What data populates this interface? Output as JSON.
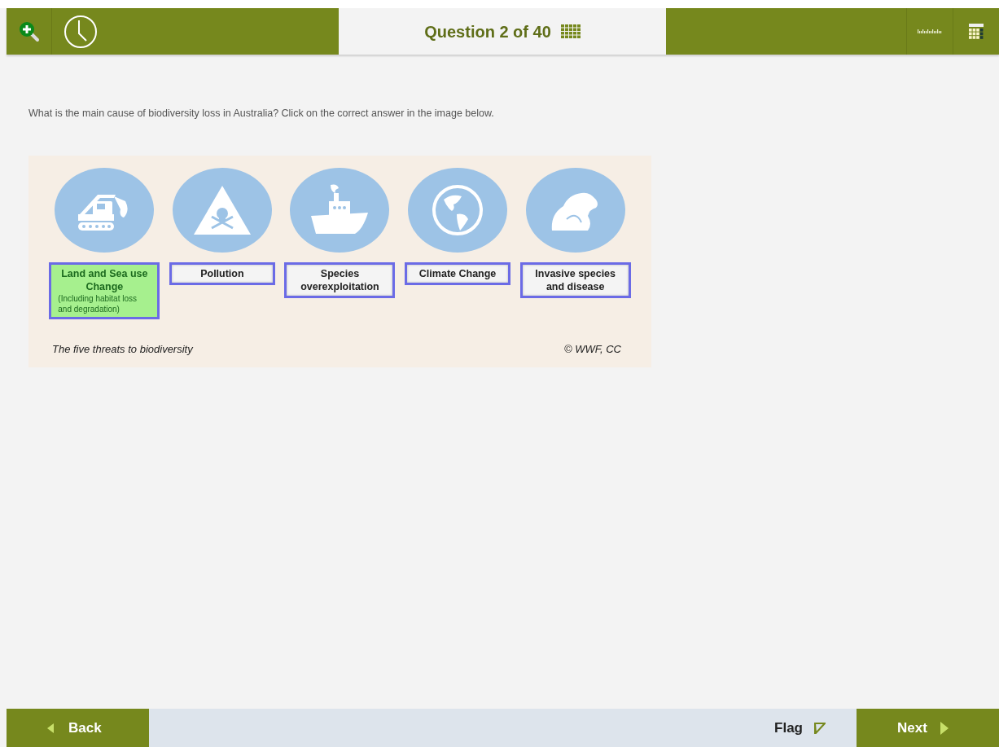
{
  "header": {
    "question_counter": "Question 2 of 40"
  },
  "question": {
    "text": "What is the main cause of biodiversity loss in Australia? Click on the correct answer in the image below."
  },
  "figure": {
    "options": [
      {
        "label": "Land and Sea use Change",
        "sublabel": "(Including habitat loss and degradation)",
        "selected": true
      },
      {
        "label": "Pollution",
        "selected": false
      },
      {
        "label": "Species overexploitation",
        "selected": false
      },
      {
        "label": "Climate Change",
        "selected": false
      },
      {
        "label": "Invasive species and disease",
        "selected": false
      }
    ],
    "caption": "The five threats to biodiversity",
    "credit": "© WWF, CC"
  },
  "footer": {
    "back": "Back",
    "flag": "Flag",
    "next": "Next"
  }
}
